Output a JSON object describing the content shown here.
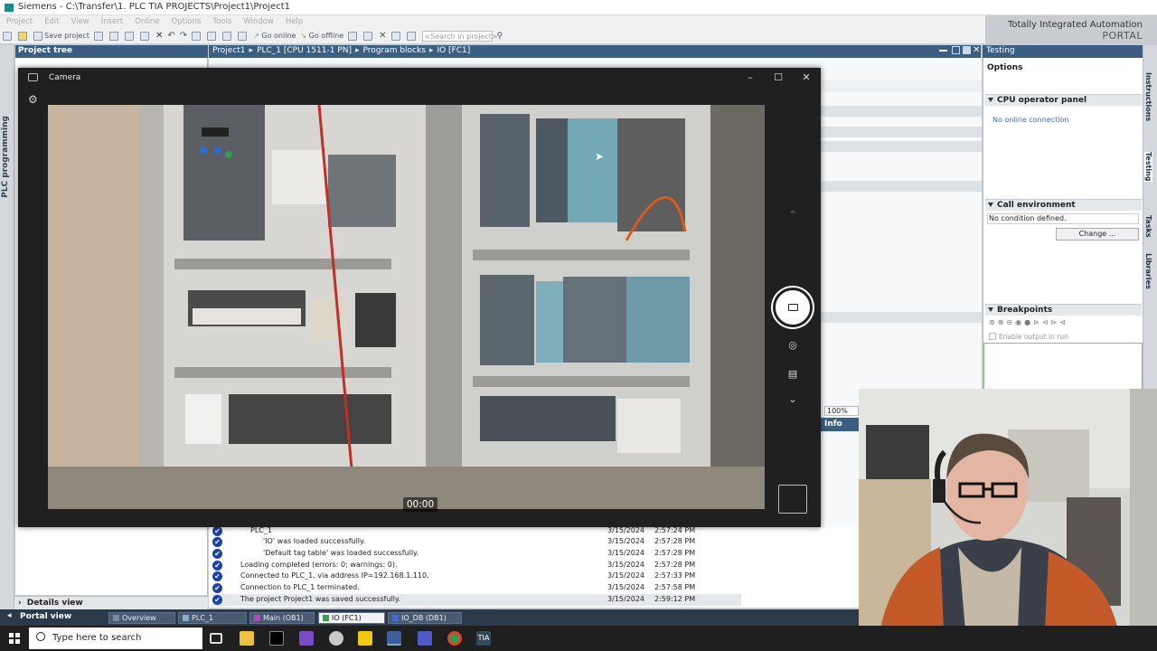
{
  "window": {
    "title": "Siemens - C:\\Transfer\\1. PLC TIA PROJECTS\\Project1\\Project1"
  },
  "menu": [
    "Project",
    "Edit",
    "View",
    "Insert",
    "Online",
    "Options",
    "Tools",
    "Window",
    "Help"
  ],
  "toolbar": {
    "save_label": "Save project",
    "go_online": "Go online",
    "go_offline": "Go offline",
    "search_placeholder": "<Search in project>"
  },
  "brand": {
    "line1": "Totally Integrated Automation",
    "line2": "PORTAL"
  },
  "left_strip": {
    "label": "PLC programming"
  },
  "project_tree": {
    "title": "Project tree"
  },
  "breadcrumb": [
    "Project1",
    "PLC_1 [CPU 1511-1 PN]",
    "Program blocks",
    "IO [FC1]"
  ],
  "testing": {
    "title": "Testing",
    "options": "Options",
    "cpu_panel": "CPU operator panel",
    "no_connection": "No online connection",
    "call_env": "Call environment",
    "no_condition": "No condition defined.",
    "change_btn": "Change ...",
    "breakpoints": "Breakpoints",
    "enable_output": "Enable output in run"
  },
  "right_tabs": [
    "Instructions",
    "Testing",
    "Tasks",
    "Libraries"
  ],
  "camera": {
    "title": "Camera",
    "timer": "00:00"
  },
  "zoom": "100%",
  "info_tab": "Info",
  "messages": [
    {
      "text": "PLC_1",
      "date": "3/15/2024",
      "time": "2:57:24 PM"
    },
    {
      "text": "'IO' was loaded successfully.",
      "date": "3/15/2024",
      "time": "2:57:28 PM"
    },
    {
      "text": "'Default tag table' was loaded successfully.",
      "date": "3/15/2024",
      "time": "2:57:28 PM"
    },
    {
      "text": "Loading completed (errors: 0; warnings: 0).",
      "date": "3/15/2024",
      "time": "2:57:28 PM"
    },
    {
      "text": "Connected to PLC_1, via address IP=192.168.1.110.",
      "date": "3/15/2024",
      "time": "2:57:33 PM"
    },
    {
      "text": "Connection to PLC_1 terminated.",
      "date": "3/15/2024",
      "time": "2:57:58 PM"
    },
    {
      "text": "The project Project1 was saved successfully.",
      "date": "3/15/2024",
      "time": "2:59:12 PM"
    }
  ],
  "details_view": "Details view",
  "portal": {
    "label": "Portal view",
    "tabs": [
      "Overview",
      "PLC_1",
      "Main (OB1)",
      "IO (FC1)",
      "IO_DB (DB1)"
    ]
  },
  "taskbar": {
    "search_placeholder": "Type here to search"
  },
  "colors": {
    "tia_header": "#3a5f82",
    "message_ok": "#1a3fb0",
    "portal_bar": "#2b3a4a"
  }
}
